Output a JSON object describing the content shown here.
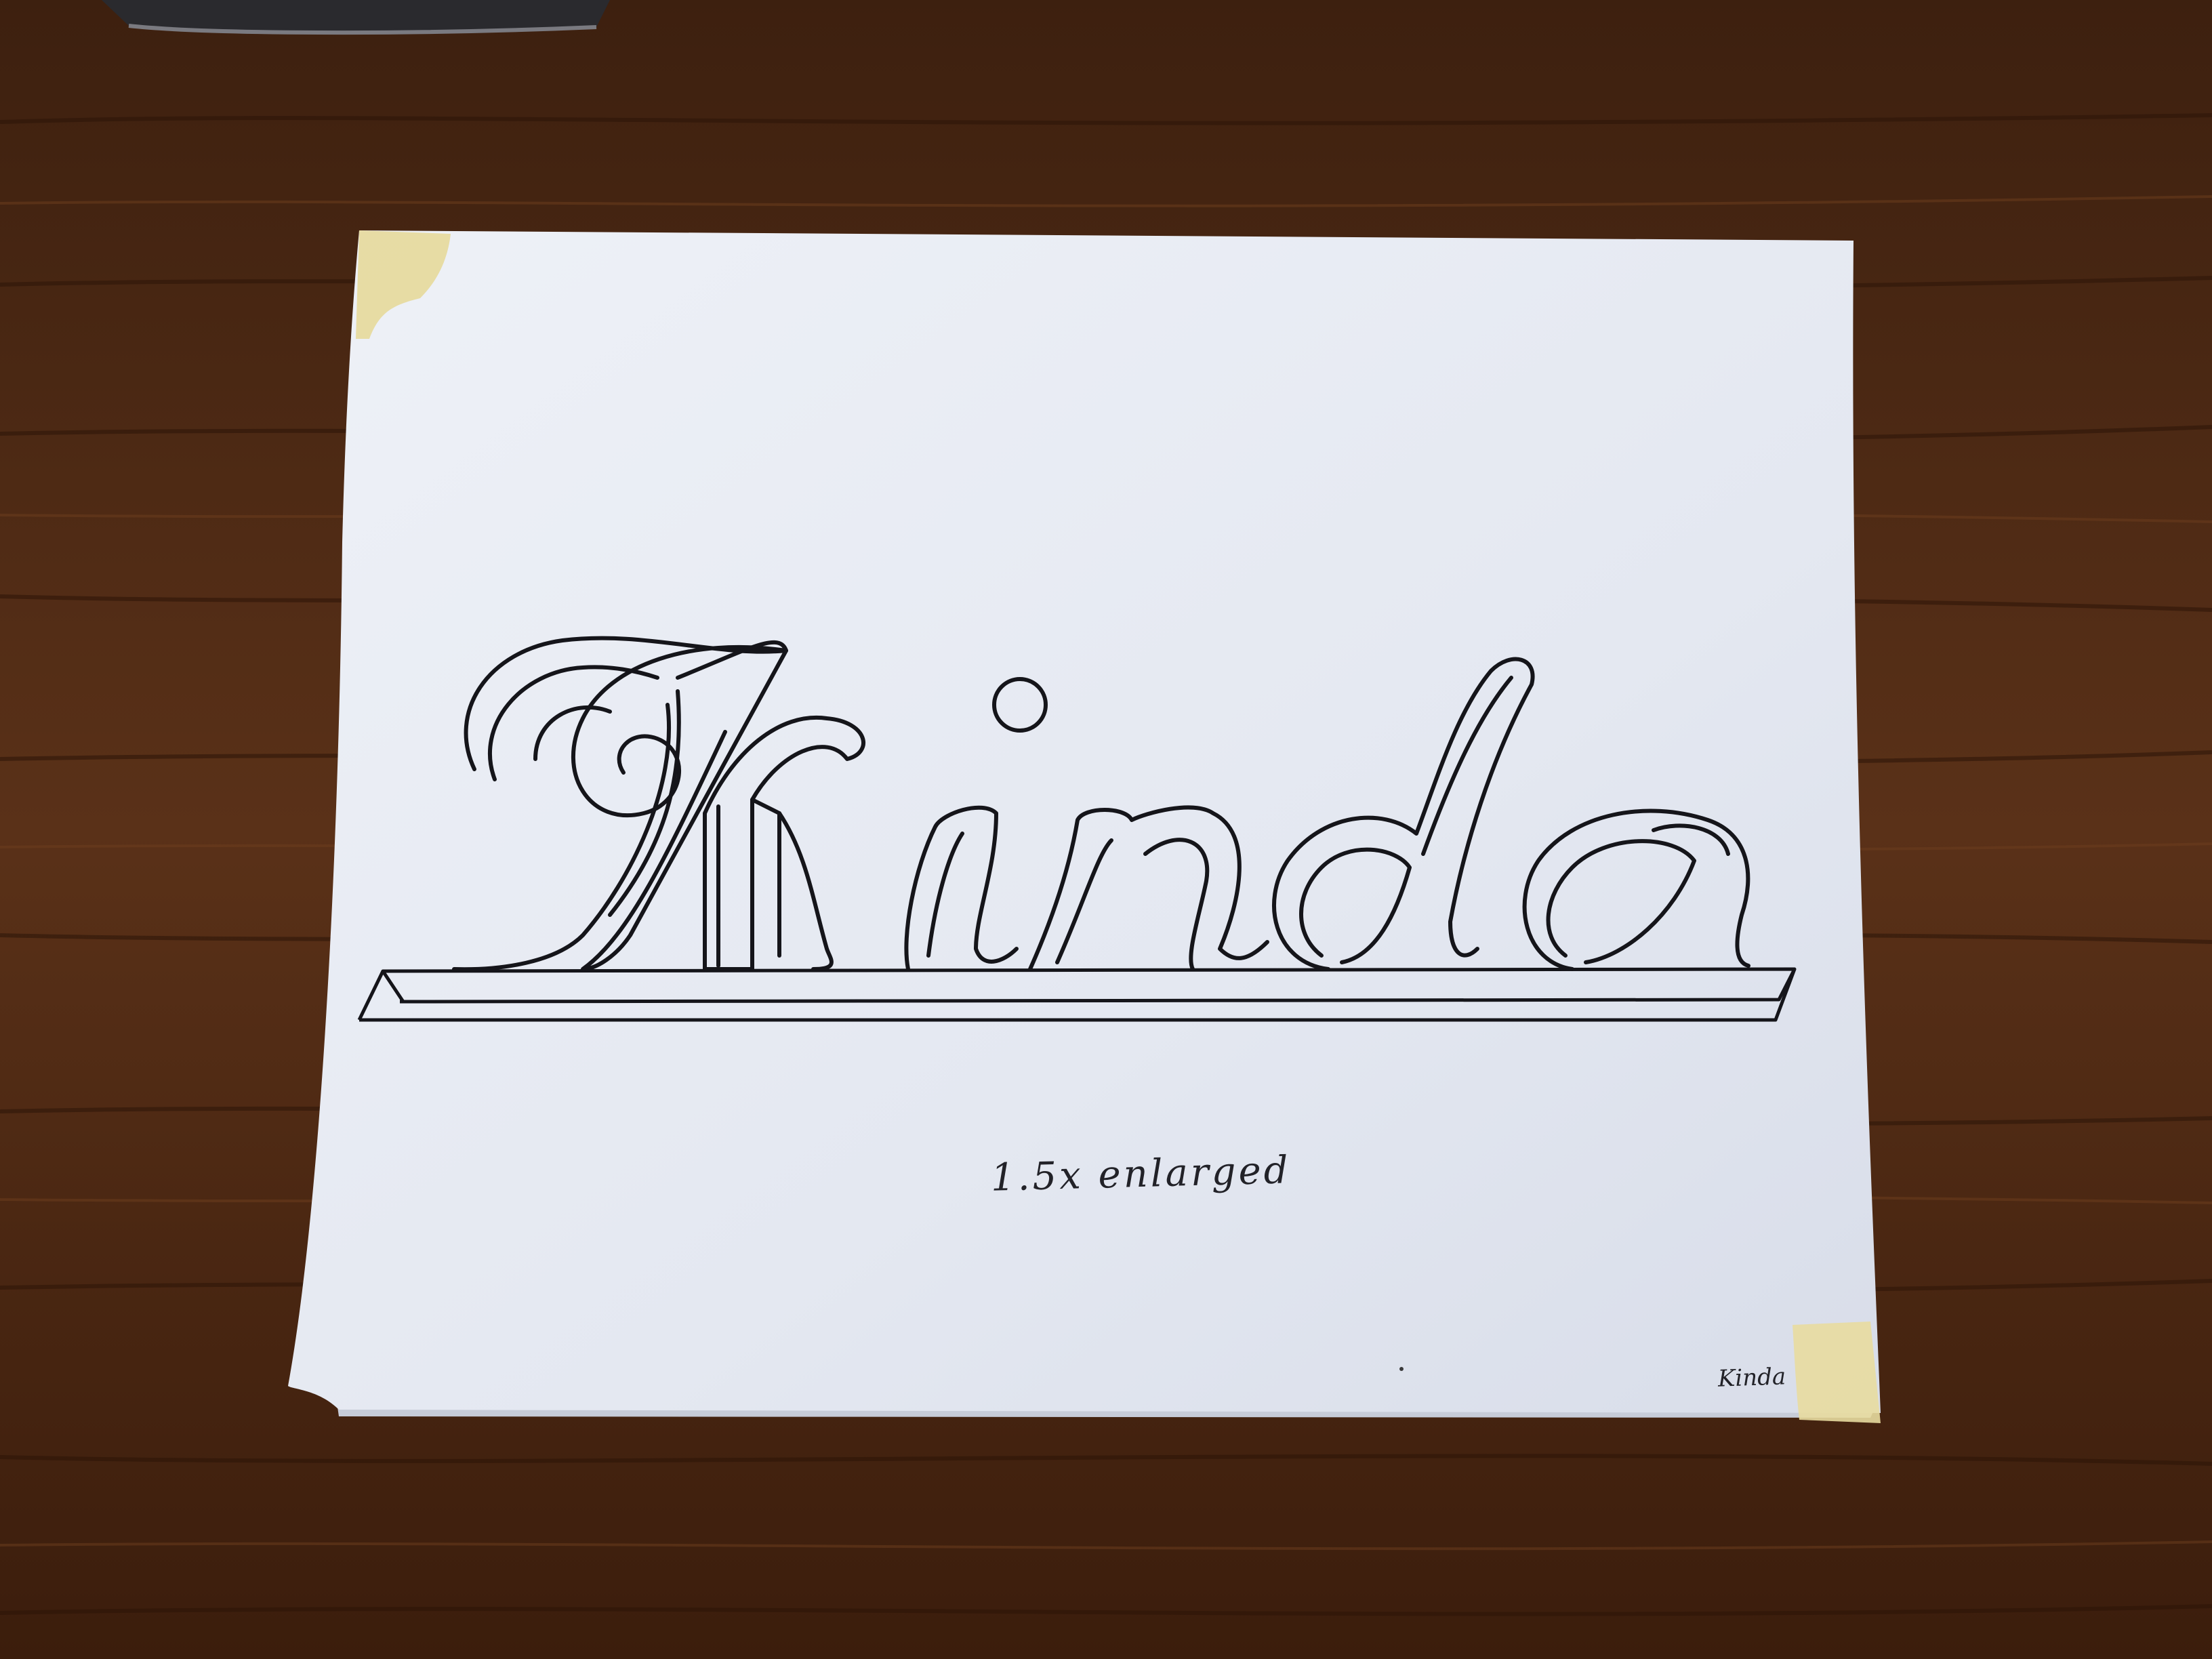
{
  "scene": {
    "description_items": {
      "paper": "paper-sheet",
      "tape": "masking-tape",
      "desk": "wooden-desk"
    }
  },
  "drawing": {
    "main_word": "Kinda",
    "caption": "1.5x enlarged",
    "corner_label": "Kinda"
  },
  "colors": {
    "desk": "#4a2814",
    "desk_grain": "#2f1609",
    "desk_light": "#6b3b1d",
    "paper": "#e6eaf3",
    "paper_shadow": "#c9cfdc",
    "ink": "#15151a",
    "tape": "#e8dca0"
  }
}
